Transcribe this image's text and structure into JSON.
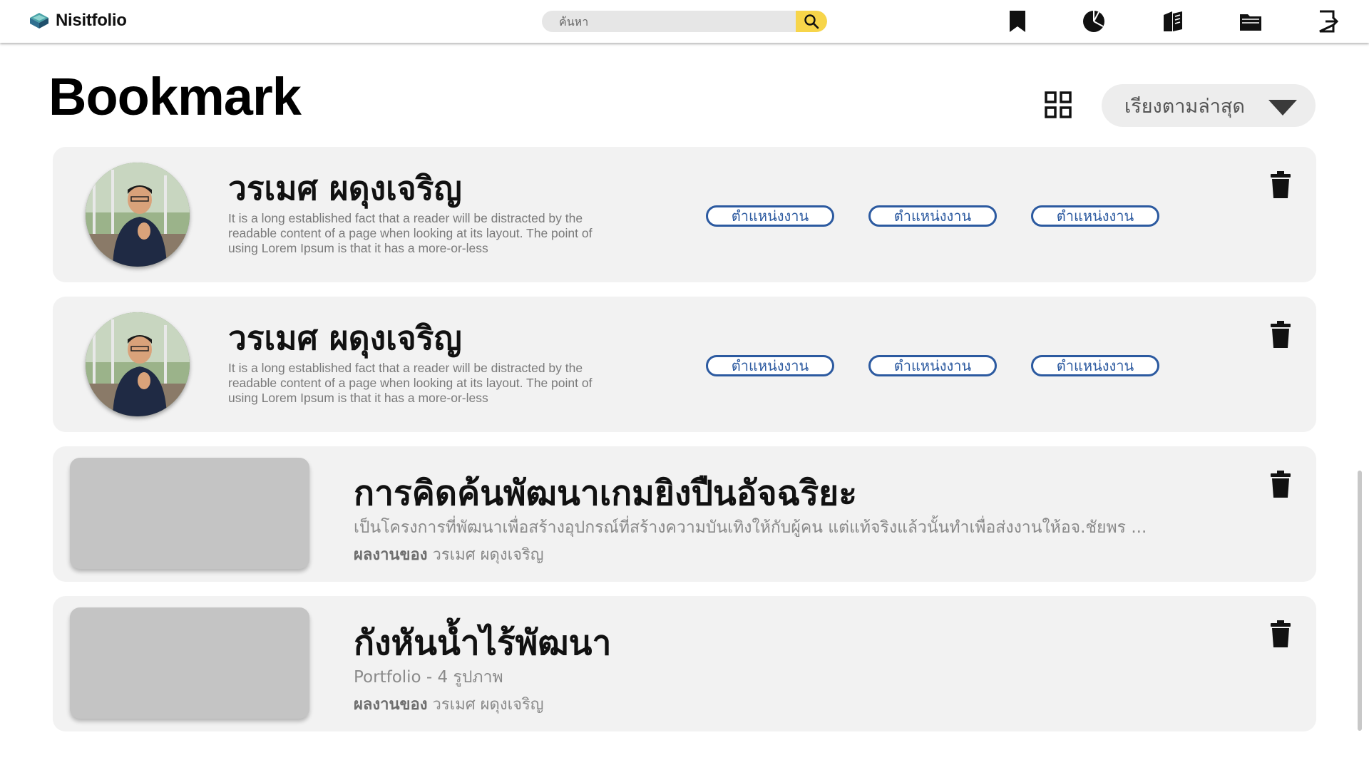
{
  "app": {
    "name": "Nisitfolio"
  },
  "search": {
    "placeholder": "ค้นหา"
  },
  "nav_icons": [
    "bookmark-icon",
    "pie-chart-icon",
    "portfolio-icon",
    "folder-icon",
    "logout-icon"
  ],
  "page": {
    "title": "Bookmark"
  },
  "sort": {
    "selected": "เรียงตามล่าสุด"
  },
  "colors": {
    "tag_border": "#2c5aa0",
    "search_button": "#f7d54a",
    "card_bg": "#f2f2f2"
  },
  "people": [
    {
      "name": "วรเมศ ผดุงเจริญ",
      "description": "It is a long established fact that a reader will be distracted by the readable content of a page when looking at its layout. The point of using Lorem Ipsum is that it has a more-or-less",
      "tags": [
        "ตำแหน่งงาน",
        "ตำแหน่งงาน",
        "ตำแหน่งงาน"
      ]
    },
    {
      "name": "วรเมศ ผดุงเจริญ",
      "description": "It is a long established fact that a reader will be distracted by the readable content of a page when looking at its layout. The point of using Lorem Ipsum is that it has a more-or-less",
      "tags": [
        "ตำแหน่งงาน",
        "ตำแหน่งงาน",
        "ตำแหน่งงาน"
      ]
    }
  ],
  "works": [
    {
      "title": "การคิดค้นพัฒนาเกมยิงปืนอัจฉริยะ",
      "subtitle": "เป็นโครงการที่พัฒนาเพื่อสร้างอุปกรณ์ที่สร้างความบันเทิงให้กับผู้คน แต่แท้จริงแล้วนั้นทำเพื่อส่งงานให้อจ.ชัยพร ...",
      "by_label": "ผลงานของ",
      "by_name": "วรเมศ ผดุงเจริญ"
    },
    {
      "title": "กังหันน้ำไร้พัฒนา",
      "subtitle": "Portfolio - 4 รูปภาพ",
      "by_label": "ผลงานของ",
      "by_name": "วรเมศ ผดุงเจริญ"
    }
  ]
}
